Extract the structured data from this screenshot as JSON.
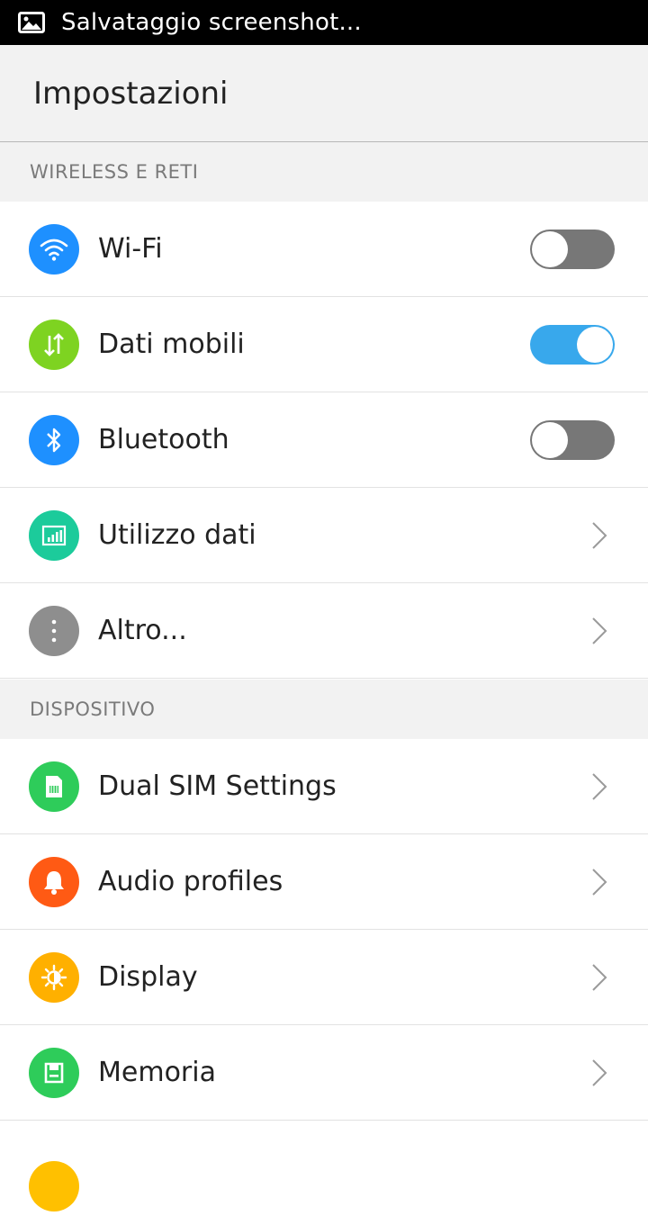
{
  "status_bar": {
    "notification_icon": "image-icon",
    "text": "Salvataggio screenshot..."
  },
  "app_bar": {
    "title": "Impostazioni"
  },
  "sections": [
    {
      "label": "WIRELESS E RETI",
      "items": [
        {
          "label": "Wi-Fi",
          "icon": "wifi-icon",
          "color": "#1e90ff",
          "control": "toggle",
          "state": "off"
        },
        {
          "label": "Dati mobili",
          "icon": "data-transfer-icon",
          "color": "#7ed321",
          "control": "toggle",
          "state": "on"
        },
        {
          "label": "Bluetooth",
          "icon": "bluetooth-icon",
          "color": "#1e90ff",
          "control": "toggle",
          "state": "off"
        },
        {
          "label": "Utilizzo dati",
          "icon": "data-usage-icon",
          "color": "#1ccb9b",
          "control": "chevron"
        },
        {
          "label": "Altro...",
          "icon": "more-icon",
          "color": "#8e8e8e",
          "control": "chevron"
        }
      ]
    },
    {
      "label": "DISPOSITIVO",
      "items": [
        {
          "label": "Dual SIM Settings",
          "icon": "sim-card-icon",
          "color": "#2ecc5a",
          "control": "chevron"
        },
        {
          "label": "Audio profiles",
          "icon": "bell-icon",
          "color": "#ff5a14",
          "control": "chevron"
        },
        {
          "label": "Display",
          "icon": "brightness-icon",
          "color": "#ffb000",
          "control": "chevron"
        },
        {
          "label": "Memoria",
          "icon": "storage-icon",
          "color": "#2ecc5a",
          "control": "chevron"
        }
      ]
    }
  ],
  "partial_next_item": {
    "icon_color": "#ffc000"
  },
  "colors": {
    "toggle_on": "#38a8ec",
    "toggle_off": "#777777",
    "section_background": "#f2f2f2"
  }
}
